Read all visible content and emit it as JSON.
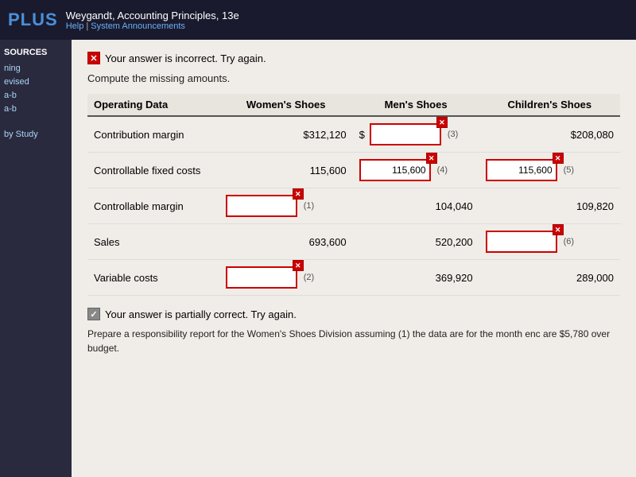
{
  "topbar": {
    "logo": "PLUS",
    "book_title": "Weygandt, Accounting Principles, 13e",
    "help_label": "Help",
    "announcements_label": "System Announcements",
    "separator": "|"
  },
  "sidebar": {
    "resources_label": "SOURCES",
    "items": [
      {
        "label": "ning"
      },
      {
        "label": "evised"
      },
      {
        "label": "a-b"
      },
      {
        "label": "a-b"
      }
    ],
    "by_study_label": "by Study"
  },
  "content": {
    "feedback_incorrect": "Your answer is incorrect.  Try again.",
    "instruction": "Compute the missing amounts.",
    "table": {
      "headers": [
        "Operating Data",
        "Women's Shoes",
        "Men's Shoes",
        "Children's Shoes"
      ],
      "rows": [
        {
          "label": "Contribution margin",
          "women_value": "$312,120",
          "women_input": null,
          "men_input": {
            "id": 3,
            "value": "",
            "has_dollar": true
          },
          "men_value": null,
          "children_value": "$208,080",
          "children_input": null
        },
        {
          "label": "Controllable fixed costs",
          "women_value": "115,600",
          "women_input": null,
          "men_input_filled": {
            "id": 4,
            "value": "115,600"
          },
          "children_input_filled": {
            "id": 5,
            "value": "115,600"
          }
        },
        {
          "label": "Controllable margin",
          "women_input": {
            "id": 1
          },
          "men_value": "104,040",
          "children_value": "109,820"
        },
        {
          "label": "Sales",
          "women_value": "693,600",
          "men_value": "520,200",
          "children_input": {
            "id": 6
          }
        },
        {
          "label": "Variable costs",
          "women_input": {
            "id": 2
          },
          "men_value": "369,920",
          "children_value": "289,000"
        }
      ]
    },
    "feedback_partial": "Your answer is partially correct.  Try again.",
    "bottom_text": "Prepare a responsibility report for the Women's Shoes Division assuming (1) the data are for the month enc are $5,780 over budget."
  }
}
